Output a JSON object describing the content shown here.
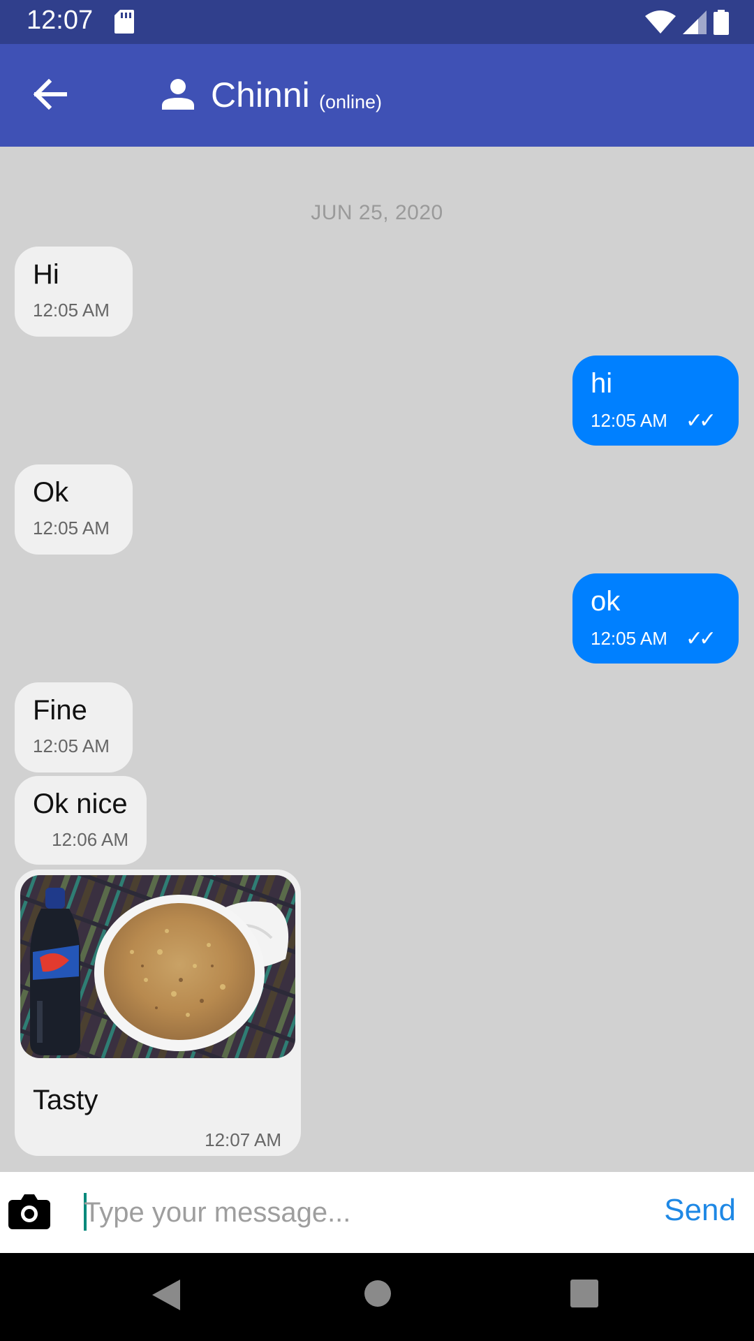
{
  "status_bar": {
    "time": "12:07",
    "icons": [
      "sd-card-icon",
      "wifi-icon",
      "signal-icon",
      "battery-icon"
    ]
  },
  "app_bar": {
    "back_icon": "arrow-back-icon",
    "avatar_icon": "person-icon",
    "contact_name": "Chinni",
    "contact_status": "(online)"
  },
  "chat": {
    "date_separator": "JUN 25, 2020",
    "messages": [
      {
        "direction": "incoming",
        "text": "Hi",
        "time": "12:05 AM"
      },
      {
        "direction": "outgoing",
        "text": "hi",
        "time": "12:05 AM",
        "ticks": "✓✓"
      },
      {
        "direction": "incoming",
        "text": "Ok",
        "time": "12:05 AM"
      },
      {
        "direction": "outgoing",
        "text": "ok",
        "time": "12:05 AM",
        "ticks": "✓✓"
      },
      {
        "direction": "incoming",
        "text": "Fine",
        "time": "12:05 AM"
      },
      {
        "direction": "incoming",
        "text": "Ok nice",
        "time": "12:06 AM"
      },
      {
        "direction": "incoming",
        "type": "image",
        "text": "Tasty",
        "time": "12:07 AM"
      }
    ]
  },
  "composer": {
    "camera_icon": "camera-icon",
    "placeholder": "Type your message...",
    "value": "",
    "send_label": "Send"
  },
  "nav_bar": {
    "icons": [
      "back-triangle-icon",
      "home-circle-icon",
      "recents-square-icon"
    ]
  },
  "colors": {
    "status_bar": "#303f8c",
    "app_bar": "#3f51b5",
    "chat_background": "#d1d1d1",
    "incoming_bubble": "#f0f0f0",
    "outgoing_bubble": "#0080ff",
    "send_text": "#1e88e5"
  }
}
